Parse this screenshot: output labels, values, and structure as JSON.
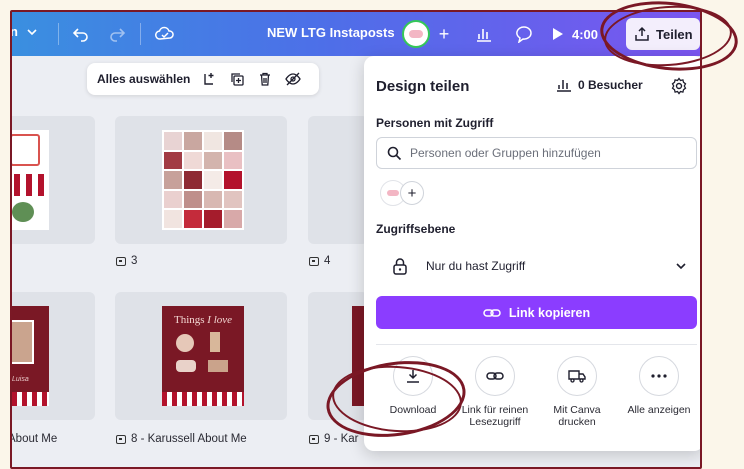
{
  "topbar": {
    "menu_fragment": "n",
    "doc_title": "NEW LTG Instaposts",
    "timer": "4:00",
    "share_label": "Teilen"
  },
  "selection_bar": {
    "select_all": "Alles auswählen"
  },
  "pages": [
    {
      "label": "3"
    },
    {
      "label": "4"
    },
    {
      "label": "About Me"
    },
    {
      "label": "8 - Karussell About Me"
    },
    {
      "label": "9 - Kar"
    }
  ],
  "thumb_text": {
    "things_title": "Things ",
    "things_italic": "I love",
    "signature": "Luisa"
  },
  "share_panel": {
    "title": "Design teilen",
    "visitors": "0 Besucher",
    "people_heading": "Personen mit Zugriff",
    "search_placeholder": "Personen oder Gruppen hinzufügen",
    "access_heading": "Zugriffsebene",
    "access_value": "Nur du hast Zugriff",
    "copy_link": "Link kopieren",
    "actions": [
      {
        "label": "Download",
        "icon": "download-icon"
      },
      {
        "label": "Link für reinen Lesezugriff",
        "icon": "link-icon"
      },
      {
        "label": "Mit Canva drucken",
        "icon": "truck-icon"
      },
      {
        "label": "Alle anzeigen",
        "icon": "more-icon"
      }
    ]
  },
  "colors": {
    "accent": "#8b3dff",
    "annotation": "#7a1825",
    "topbar_start": "#3a8fe0",
    "topbar_end": "#7b55f0"
  }
}
